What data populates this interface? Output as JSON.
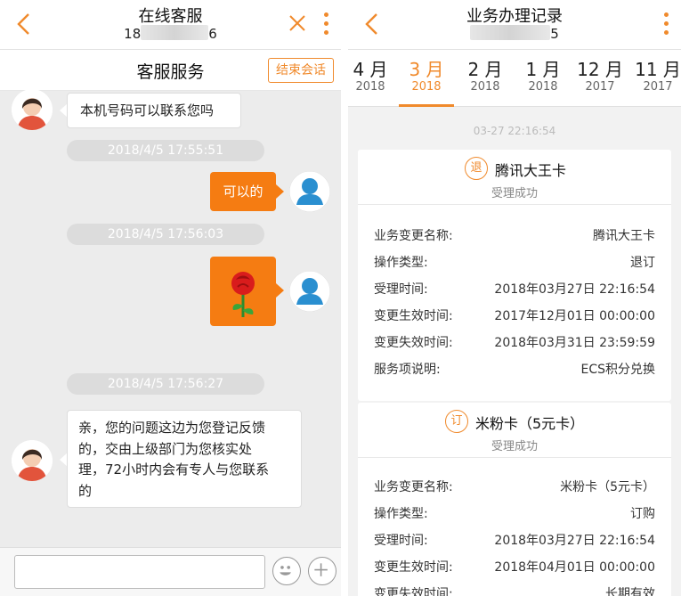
{
  "left": {
    "title": "在线客服",
    "phone_prefix": "18",
    "phone_suffix": "6",
    "service_title": "客服服务",
    "end_session": "结束会话",
    "messages": [
      {
        "type": "agent",
        "text": "本机号码可以联系您吗"
      },
      {
        "type": "time",
        "text": "2018/4/5 17:55:51"
      },
      {
        "type": "user",
        "text": "可以的"
      },
      {
        "type": "time",
        "text": "2018/4/5 17:56:03"
      },
      {
        "type": "user_image",
        "icon": "rose-icon"
      },
      {
        "type": "time",
        "text": "2018/4/5 17:56:27"
      },
      {
        "type": "agent",
        "lines": [
          "亲，您的问题这边为您登记反馈",
          "的，交由上级部门为您核实处",
          "理，72小时内会有专人与您联系",
          "的"
        ]
      }
    ],
    "input_placeholder": ""
  },
  "right": {
    "title": "业务办理记录",
    "phone_suffix": "5",
    "tabs": [
      {
        "month": "4 月",
        "year": "2018"
      },
      {
        "month": "3 月",
        "year": "2018",
        "active": true
      },
      {
        "month": "2 月",
        "year": "2018"
      },
      {
        "month": "1 月",
        "year": "2018"
      },
      {
        "month": "12 月",
        "year": "2017"
      },
      {
        "month": "11 月",
        "year": "2017"
      }
    ],
    "timestamp": "03-27 22:16:54",
    "cards": [
      {
        "badge": "退",
        "name": "腾讯大王卡",
        "status": "受理成功",
        "rows": [
          {
            "k": "业务变更名称:",
            "v": "腾讯大王卡"
          },
          {
            "k": "操作类型:",
            "v": "退订"
          },
          {
            "k": "受理时间:",
            "v": "2018年03月27日 22:16:54"
          },
          {
            "k": "变更生效时间:",
            "v": "2017年12月01日 00:00:00"
          },
          {
            "k": "变更失效时间:",
            "v": "2018年03月31日 23:59:59"
          },
          {
            "k": "服务项说明:",
            "v": "ECS积分兑换"
          }
        ]
      },
      {
        "badge": "订",
        "name": "米粉卡（5元卡）",
        "status": "受理成功",
        "rows": [
          {
            "k": "业务变更名称:",
            "v": "米粉卡（5元卡）"
          },
          {
            "k": "操作类型:",
            "v": "订购"
          },
          {
            "k": "受理时间:",
            "v": "2018年03月27日 22:16:54"
          },
          {
            "k": "变更生效时间:",
            "v": "2018年04月01日 00:00:00"
          },
          {
            "k": "变更失效时间:",
            "v": "长期有效"
          }
        ]
      }
    ]
  },
  "colors": {
    "accent": "#f08a2c",
    "bubble_out": "#f57c12",
    "chat_bg": "#ececec"
  }
}
